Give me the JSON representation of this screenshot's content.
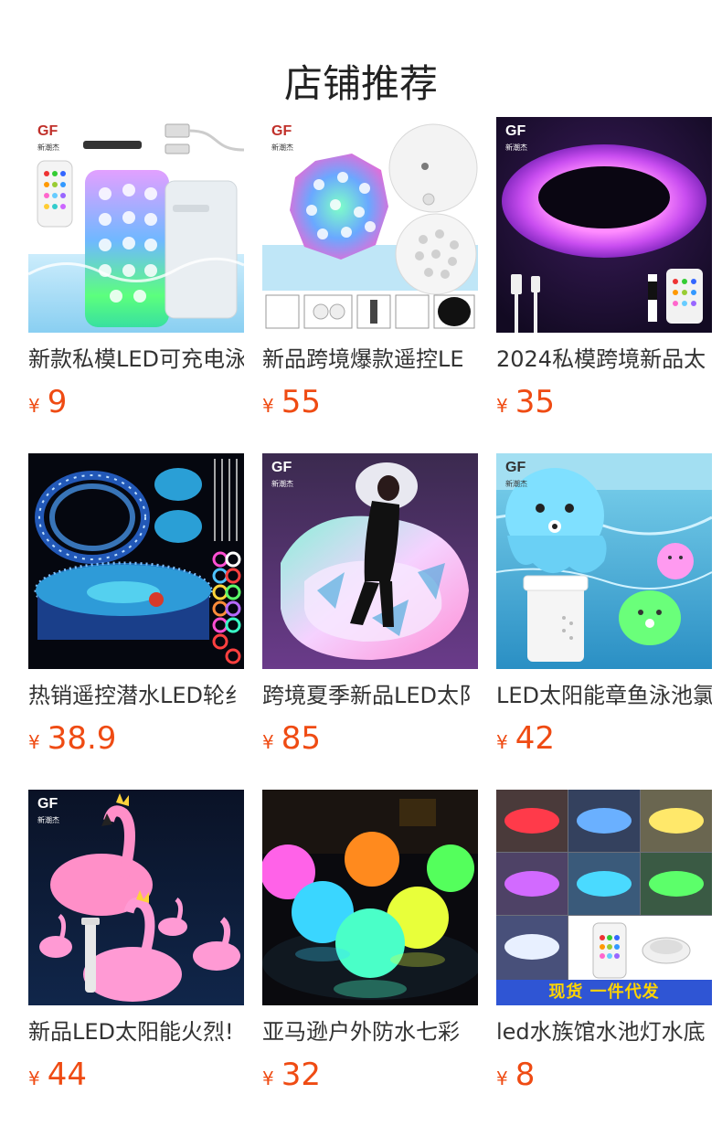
{
  "section": {
    "title": "店铺推荐"
  },
  "products": [
    {
      "name": "新款私模LED可充电泳",
      "currency": "¥",
      "price": "9",
      "image_icon": "rechargeable-pool-light-image",
      "logo": {
        "mark": "GF",
        "sub": "新潮杰"
      }
    },
    {
      "name": "新品跨境爆款遥控LE",
      "currency": "¥",
      "price": "55",
      "image_icon": "submersible-led-light-image",
      "logo": {
        "mark": "GF",
        "sub": "新潮杰"
      }
    },
    {
      "name": "2024私模跨境新品太",
      "currency": "¥",
      "price": "35",
      "image_icon": "led-ring-light-image",
      "logo": {
        "mark": "GF",
        "sub": "新潮杰"
      }
    },
    {
      "name": "热销遥控潜水LED轮纟",
      "currency": "¥",
      "price": "38.9",
      "image_icon": "led-strip-pool-image"
    },
    {
      "name": "跨境夏季新品LED太阝",
      "currency": "¥",
      "price": "85",
      "image_icon": "inflatable-float-image",
      "logo": {
        "mark": "GF",
        "sub": "新潮杰"
      }
    },
    {
      "name": "LED太阳能章鱼泳池氯",
      "currency": "¥",
      "price": "42",
      "image_icon": "octopus-chlorine-dispenser-image",
      "logo": {
        "mark": "GF",
        "sub": "新潮杰"
      }
    },
    {
      "name": "新品LED太阳能火烈!",
      "currency": "¥",
      "price": "44",
      "image_icon": "flamingo-light-image",
      "logo": {
        "mark": "GF",
        "sub": "新潮杰"
      }
    },
    {
      "name": "亚马逊户外防水七彩",
      "currency": "¥",
      "price": "32",
      "image_icon": "glowing-ball-image"
    },
    {
      "name": "led水族馆水池灯水底",
      "currency": "¥",
      "price": "8",
      "image_icon": "aquarium-light-grid-image",
      "banner": "现货  一件代发"
    }
  ],
  "colors": {
    "price": "#ef4b13",
    "title": "#222222",
    "text": "#333333"
  }
}
